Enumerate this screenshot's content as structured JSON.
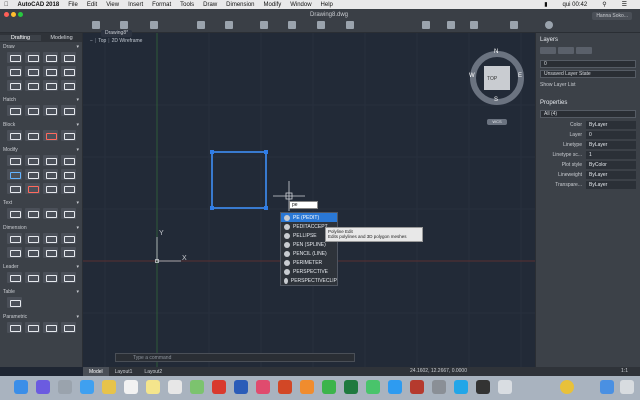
{
  "menubar": {
    "app": "AutoCAD 2018",
    "items": [
      "File",
      "Edit",
      "View",
      "Insert",
      "Format",
      "Tools",
      "Draw",
      "Dimension",
      "Modify",
      "Window",
      "Help"
    ],
    "clock": "qui 00:42"
  },
  "toolbar": {
    "doc_title": "Drawing8.dwg",
    "user": "Hanna Soko..."
  },
  "left_panel": {
    "tabs": [
      "Drafting",
      "Modeling"
    ],
    "sections": [
      "Draw",
      "Hatch",
      "Block",
      "Modify",
      "Text",
      "Dimension",
      "Leader",
      "Table",
      "Parametric"
    ]
  },
  "canvas": {
    "doc_tab": "Drawing8*",
    "view_label": "Top",
    "visual_style": "2D Wireframe",
    "viewcube_top": "TOP",
    "viewcube_n": "N",
    "viewcube_s": "S",
    "viewcube_e": "E",
    "viewcube_w": "W",
    "wcs_label": "WCS",
    "ucs_x": "X",
    "ucs_y": "Y"
  },
  "autocomplete": {
    "input": "pe",
    "items": [
      "PE (PEDIT)",
      "PEDITACCEPT",
      "PELLIPSE",
      "PEN (SPLINE)",
      "PENCIL (LINE)",
      "PERIMETER",
      "PERSPECTIVE",
      "PERSPECTIVECLIP"
    ],
    "selected_index": 0
  },
  "tooltip": {
    "title": "Polyline Edit",
    "desc": "Edits polylines and 3D polygon meshes"
  },
  "command_line": {
    "placeholder": "Type a command"
  },
  "status": {
    "tabs": [
      "Model",
      "Layout1",
      "Layout2"
    ],
    "coords": "24.1602, 12.2667, 0.0000",
    "scale": "1:1"
  },
  "right_panel": {
    "layers_title": "Layers",
    "layer_state": "Unsaved Layer State",
    "show_layer_list": "Show Layer List",
    "layer_value": "0",
    "properties_title": "Properties",
    "selection": "All (4)",
    "props": [
      {
        "k": "Color",
        "v": "ByLayer"
      },
      {
        "k": "Layer",
        "v": "0"
      },
      {
        "k": "Linetype",
        "v": "ByLayer"
      },
      {
        "k": "Linetype sc...",
        "v": "1"
      },
      {
        "k": "Plot style",
        "v": "ByColor"
      },
      {
        "k": "Lineweight",
        "v": "ByLayer"
      },
      {
        "k": "Transpare...",
        "v": "ByLayer"
      }
    ]
  }
}
